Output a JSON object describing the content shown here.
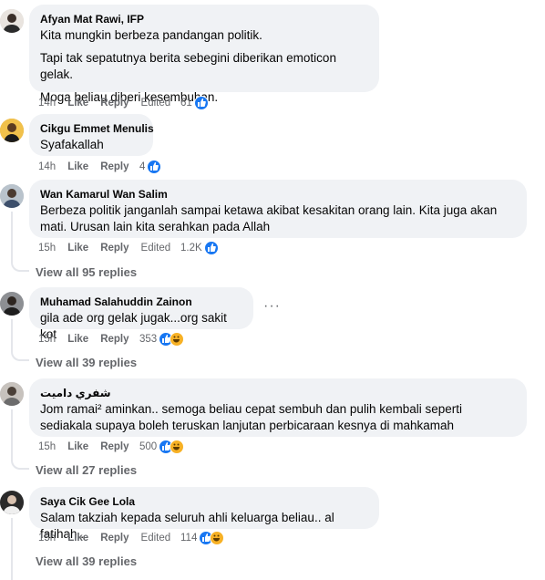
{
  "comments": [
    {
      "author": "Afyan Mat Rawi, IFP",
      "paragraphs": [
        "Kita mungkin berbeza pandangan politik.",
        "Tapi tak sepatutnya berita sebegini diberikan emoticon gelak.",
        "Moga beliau diberi kesembuhan."
      ],
      "time": "14h",
      "like": "Like",
      "reply": "Reply",
      "edited": "Edited",
      "reaction_count": "61",
      "reaction_icons": [
        "like-icon"
      ]
    },
    {
      "author": "Cikgu Emmet Menulis",
      "paragraphs": [
        "Syafakallah"
      ],
      "time": "14h",
      "like": "Like",
      "reply": "Reply",
      "reaction_count": "4",
      "reaction_icons": [
        "like-icon"
      ]
    },
    {
      "author": "Wan Kamarul Wan Salim",
      "paragraphs": [
        "Berbeza politik janganlah sampai ketawa akibat kesakitan orang lain. Kita juga akan mati. Urusan lain kita serahkan pada Allah"
      ],
      "time": "15h",
      "like": "Like",
      "reply": "Reply",
      "edited": "Edited",
      "reaction_count": "1.2K",
      "reaction_icons": [
        "like-icon"
      ],
      "view_replies": "View all 95 replies"
    },
    {
      "author": "Muhamad Salahuddin Zainon",
      "paragraphs": [
        "gila ade org gelak jugak...org sakit kot"
      ],
      "time": "15h",
      "like": "Like",
      "reply": "Reply",
      "reaction_count": "353",
      "reaction_icons": [
        "like-icon",
        "haha-icon"
      ],
      "view_replies": "View all 39 replies",
      "more": "···"
    },
    {
      "author": "شفري داميت",
      "paragraphs": [
        "Jom ramai² aminkan.. semoga beliau cepat sembuh dan pulih kembali seperti sediakala supaya boleh teruskan lanjutan perbicaraan kesnya di mahkamah"
      ],
      "time": "15h",
      "like": "Like",
      "reply": "Reply",
      "reaction_count": "500",
      "reaction_icons": [
        "like-icon",
        "haha-icon"
      ],
      "view_replies": "View all 27 replies"
    },
    {
      "author": "Saya Cik Gee Lola",
      "paragraphs": [
        "Salam takziah kepada seluruh ahli keluarga beliau.. al fatihah.."
      ],
      "time": "15h",
      "like": "Like",
      "reply": "Reply",
      "edited": "Edited",
      "reaction_count": "114",
      "reaction_icons": [
        "like-icon",
        "haha-icon"
      ],
      "view_replies": "View all 39 replies"
    }
  ],
  "colors": {
    "bubble": "#f0f2f5",
    "meta_text": "#65676b",
    "like_blue": "#1877f2",
    "haha_yellow": "#f7b125",
    "thread_line": "#e4e6eb"
  }
}
